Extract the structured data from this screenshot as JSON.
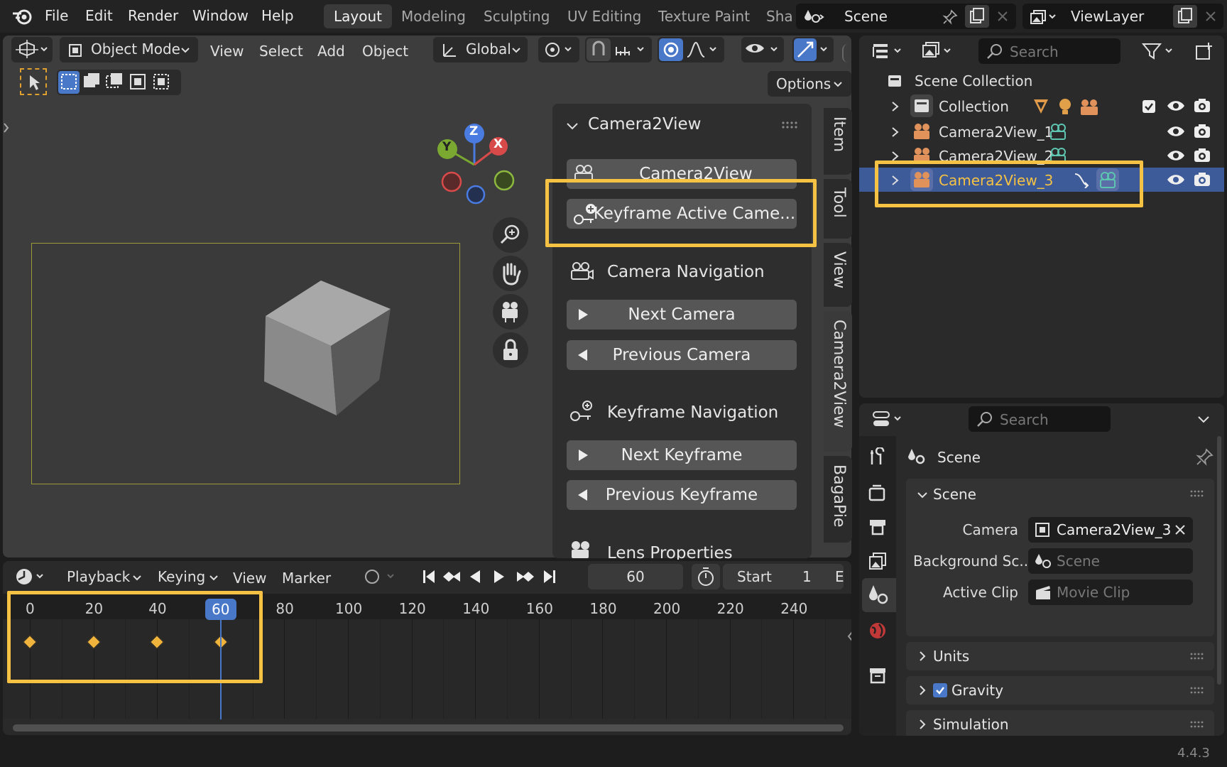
{
  "menu": {
    "file": "File",
    "edit": "Edit",
    "render": "Render",
    "window": "Window",
    "help": "Help"
  },
  "workspaces": [
    "Layout",
    "Modeling",
    "Sculpting",
    "UV Editing",
    "Texture Paint",
    "Sha"
  ],
  "scene_field": "Scene",
  "viewlayer_field": "ViewLayer",
  "viewport_header": {
    "mode": "Object Mode",
    "view": "View",
    "select": "Select",
    "add": "Add",
    "object": "Object",
    "orientation": "Global",
    "options": "Options"
  },
  "gizmo": {
    "z": "Z",
    "y": "Y",
    "x": "X"
  },
  "npanel": {
    "title": "Camera2View",
    "btn_camera2view": "Camera2View",
    "btn_keyframe_active": "Keyframe Active Came...",
    "camera_nav": "Camera Navigation",
    "btn_next_camera": "Next Camera",
    "btn_prev_camera": "Previous Camera",
    "keyframe_nav": "Keyframe Navigation",
    "btn_next_keyframe": "Next Keyframe",
    "btn_prev_keyframe": "Previous Keyframe",
    "lens": "Lens Properties"
  },
  "vtabs": [
    "Item",
    "Tool",
    "View",
    "Camera2View",
    "BagaPie"
  ],
  "timeline": {
    "playback": "Playback",
    "keying": "Keying",
    "view": "View",
    "marker": "Marker",
    "current_frame": "60",
    "start_label": "Start",
    "start_value": "1",
    "end_label": "E",
    "ticks": [
      "0",
      "20",
      "40",
      "60",
      "80",
      "100",
      "120",
      "140",
      "160",
      "180",
      "200",
      "220",
      "240"
    ],
    "keyframes": [
      0,
      20,
      40,
      60
    ],
    "playhead": 60
  },
  "outliner": {
    "search": "Search",
    "scene_collection": "Scene Collection",
    "collection": "Collection",
    "items": [
      "Camera2View_1",
      "Camera2View_2",
      "Camera2View_3"
    ]
  },
  "properties": {
    "search": "Search",
    "title": "Scene",
    "section": "Scene",
    "camera_label": "Camera",
    "camera_value": "Camera2View_3",
    "bg_label": "Background Sc...",
    "bg_value": "Scene",
    "clip_label": "Active Clip",
    "clip_value": "Movie Clip",
    "units": "Units",
    "gravity": "Gravity",
    "simulation": "Simulation"
  },
  "version": "4.4.3",
  "colors": {
    "highlight": "#f5c244",
    "selection": "#3d5a99",
    "keyframe": "#f0b43c",
    "playhead": "#4a78c8",
    "camera_orange": "#e0925a",
    "camera_teal": "#5dc5b0"
  }
}
